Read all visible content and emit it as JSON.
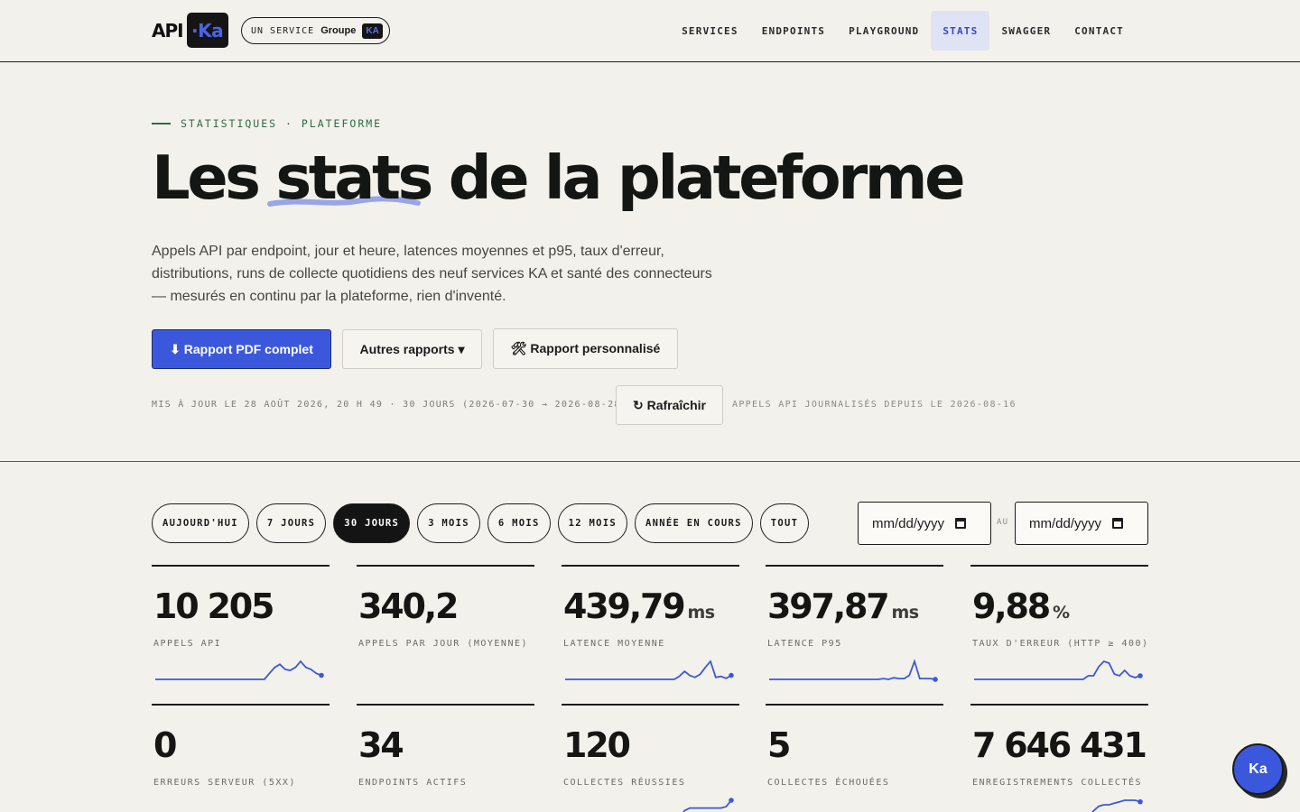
{
  "header": {
    "logo_api": "API",
    "logo_ka": "·Ka",
    "service_prefix": "UN SERVICE",
    "service_group": "Groupe",
    "service_badge": "KA",
    "nav": [
      {
        "label": "SERVICES"
      },
      {
        "label": "ENDPOINTS"
      },
      {
        "label": "PLAYGROUND"
      },
      {
        "label": "STATS",
        "active": true
      },
      {
        "label": "SWAGGER"
      },
      {
        "label": "CONTACT"
      }
    ]
  },
  "hero": {
    "eyebrow": "STATISTIQUES · PLATEFORME",
    "title_before": "Les ",
    "title_highlight": "stats",
    "title_after": " de la plateforme",
    "description": "Appels API par endpoint, jour et heure, latences moyennes et p95, taux d'erreur, distributions, runs de collecte quotidiens des neuf services KA et santé des connecteurs — mesurés en continu par la plateforme, rien d'inventé.",
    "btn_pdf": "⬇ Rapport PDF complet",
    "btn_other": "Autres rapports ▾",
    "btn_custom": "🛠 Rapport personnalisé",
    "updated": "MIS À JOUR LE 28 AOÛT 2026, 20 H 49 · 30 JOURS (2026-07-30 → 2026-08-28)",
    "btn_refresh": "↻ Rafraîchir",
    "since": "APPELS API JOURNALISÉS DEPUIS LE 2026-08-16"
  },
  "filters": {
    "ranges": [
      "AUJOURD'HUI",
      "7 JOURS",
      "30 JOURS",
      "3 MOIS",
      "6 MOIS",
      "12 MOIS",
      "ANNÉE EN COURS",
      "TOUT"
    ],
    "active_range": "30 JOURS",
    "date_from_placeholder": "mm/dd/yyyy",
    "date_to_placeholder": "mm/dd/yyyy",
    "separator": "AU"
  },
  "stats": [
    {
      "value": "10 205",
      "unit": "",
      "label": "APPELS API",
      "spark": [
        0,
        0,
        0,
        0,
        0,
        0,
        0,
        0,
        0,
        0,
        0,
        0,
        0,
        0,
        0,
        0,
        0,
        0,
        0,
        0,
        0,
        0,
        6,
        12,
        15,
        10,
        9,
        12,
        18,
        12,
        10,
        6,
        4
      ]
    },
    {
      "value": "340,2",
      "unit": "",
      "label": "APPELS PAR JOUR (MOYENNE)",
      "spark": []
    },
    {
      "value": "439,79",
      "unit": "ms",
      "label": "LATENCE MOYENNE",
      "spark": [
        0,
        0,
        0,
        0,
        0,
        0,
        0,
        0,
        0,
        0,
        0,
        0,
        0,
        0,
        0,
        0,
        0,
        0,
        0,
        0,
        0,
        0,
        3,
        8,
        4,
        2,
        5,
        12,
        18,
        2,
        3,
        1,
        4
      ]
    },
    {
      "value": "397,87",
      "unit": "ms",
      "label": "LATENCE P95",
      "spark": [
        0,
        0,
        0,
        0,
        0,
        0,
        0,
        0,
        0,
        0,
        0,
        0,
        0,
        0,
        0,
        0,
        0,
        0,
        0,
        0,
        0,
        0,
        1,
        0,
        2,
        1,
        1,
        5,
        22,
        1,
        1,
        1,
        0
      ]
    },
    {
      "value": "9,88",
      "unit": "%",
      "label": "TAUX D'ERREUR (HTTP ≥ 400)",
      "spark": [
        0,
        0,
        0,
        0,
        0,
        0,
        0,
        0,
        0,
        0,
        0,
        0,
        0,
        0,
        0,
        0,
        0,
        0,
        0,
        0,
        0,
        0,
        4,
        4,
        14,
        20,
        18,
        6,
        4,
        10,
        4,
        2,
        4
      ]
    },
    {
      "value": "0",
      "unit": "",
      "label": "ERREURS SERVEUR (5XX)",
      "spark": []
    },
    {
      "value": "34",
      "unit": "",
      "label": "ENDPOINTS ACTIFS",
      "spark": []
    },
    {
      "value": "120",
      "unit": "",
      "label": "COLLECTES RÉUSSIES",
      "spark": [
        0,
        0,
        0,
        0,
        0,
        0,
        0,
        0,
        0,
        0,
        0,
        0,
        0,
        0,
        0,
        0,
        0,
        0,
        0,
        0,
        0,
        0,
        0,
        6,
        8,
        8,
        8,
        8,
        8,
        8,
        8,
        9,
        14
      ]
    },
    {
      "value": "5",
      "unit": "",
      "label": "COLLECTES ÉCHOUÉES",
      "spark": []
    },
    {
      "value": "7 646 431",
      "unit": "",
      "label": "ENREGISTREMENTS COLLECTÉS",
      "spark": [
        0,
        0,
        0,
        0,
        0,
        0,
        0,
        0,
        0,
        0,
        0,
        0,
        0,
        0,
        0,
        0,
        0,
        0,
        0,
        0,
        0,
        0,
        0,
        5,
        8,
        9,
        9,
        10,
        11,
        12,
        12,
        12,
        11
      ]
    }
  ],
  "fab_label": "Ka",
  "colors": {
    "accent": "#3b58dc",
    "eyebrow": "#2e6b46",
    "background": "#f3f1ec"
  }
}
